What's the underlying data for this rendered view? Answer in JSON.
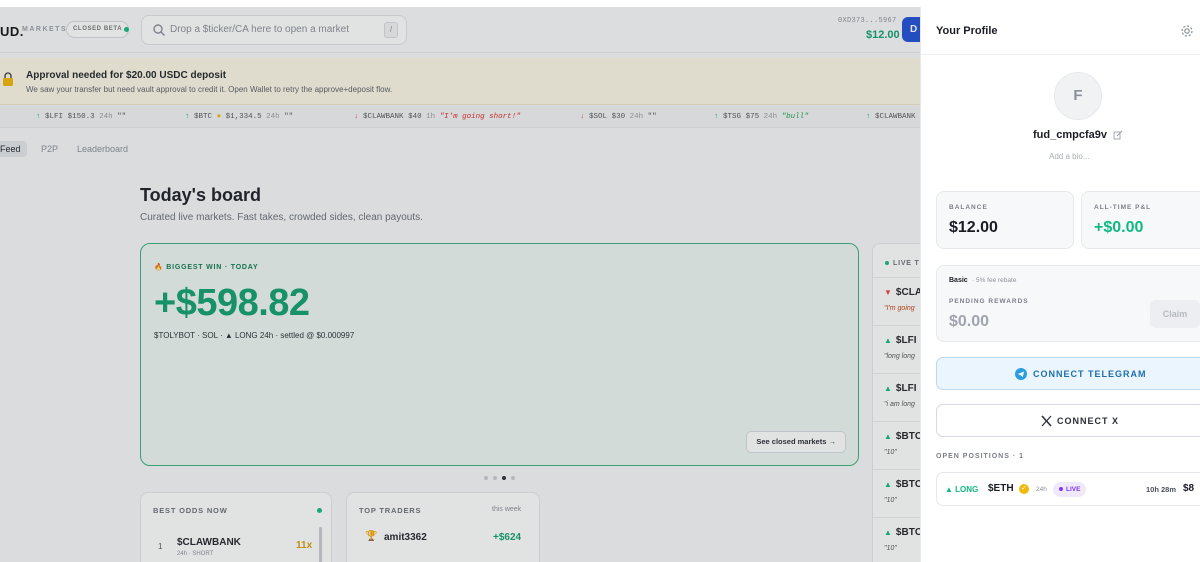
{
  "header": {
    "logo": "UD.",
    "logo_sub": "MARKETS",
    "beta": "CLOSED BETA",
    "search_placeholder": "Drop a $ticker/CA here to open a market",
    "search_kbd": "/",
    "wallet_address": "0XD373...5967",
    "wallet_balance": "$12.00",
    "deposit_label": "D"
  },
  "banner": {
    "title": "Approval needed for $20.00 USDC deposit",
    "desc": "We saw your transfer but need vault approval to credit it. Open Wallet to retry the approve+deposit flow."
  },
  "ticker": [
    {
      "dir": "↑",
      "sym": "$LFI",
      "price": "$150.3",
      "dur": "24h",
      "quote": "\"\""
    },
    {
      "dir": "↑",
      "sym": "$BTC",
      "price": "$1,334.5",
      "dur": "24h",
      "quote": "\"\""
    },
    {
      "dir": "↓",
      "sym": "$CLAWBANK",
      "price": "$40",
      "dur": "1h",
      "quote": "\"I'm going short!\""
    },
    {
      "dir": "↓",
      "sym": "$SOL",
      "price": "$30",
      "dur": "24h",
      "quote": "\"\""
    },
    {
      "dir": "↑",
      "sym": "$TSG",
      "price": "$75",
      "dur": "24h",
      "quote": "\"bull\""
    },
    {
      "dir": "↑",
      "sym": "$CLAWBANK",
      "price": "",
      "dur": "",
      "quote": ""
    }
  ],
  "tabs": [
    "Feed",
    "P2P",
    "Leaderboard"
  ],
  "board": {
    "title": "Today's board",
    "subtitle": "Curated live markets. Fast takes, crowded sides, clean payouts."
  },
  "win_card": {
    "label": "BIGGEST WIN · TODAY",
    "amount": "+$598.82",
    "meta": "$TOLYBOT · SOL · ▲ LONG 24h · settled @ $0.000997",
    "button": "See closed markets →"
  },
  "best_odds": {
    "title": "BEST ODDS NOW",
    "rank": "1",
    "name": "$CLAWBANK",
    "sub": "24h · SHORT",
    "mult": "11x"
  },
  "top_traders": {
    "title": "TOP TRADERS",
    "period": "this week",
    "name": "amit3362",
    "pnl": "+$624"
  },
  "live": {
    "title": "LIVE T",
    "items": [
      {
        "dir": "down",
        "sym": "$CLA",
        "quote": "\"I'm going"
      },
      {
        "dir": "up",
        "sym": "$LFI",
        "quote": "\"long long"
      },
      {
        "dir": "up",
        "sym": "$LFI",
        "quote": "\"i am long"
      },
      {
        "dir": "up",
        "sym": "$BTC",
        "quote": "\"10\""
      },
      {
        "dir": "up",
        "sym": "$BTC",
        "quote": "\"10\""
      },
      {
        "dir": "up",
        "sym": "$BTC",
        "quote": "\"10\""
      }
    ]
  },
  "profile": {
    "title": "Your Profile",
    "avatar_letter": "F",
    "username": "fud_cmpcfa9v",
    "bio_placeholder": "Add a bio...",
    "balance_label": "BALANCE",
    "balance": "$12.00",
    "pnl_label": "ALL-TIME P&L",
    "pnl": "+$0.00",
    "tier": "Basic",
    "tier_sub": "· 5% fee rebate",
    "pending_label": "PENDING REWARDS",
    "pending": "$0.00",
    "claim": "Claim",
    "telegram": "CONNECT TELEGRAM",
    "x": "CONNECT X",
    "positions_label": "OPEN POSITIONS · 1",
    "position": {
      "side": "▲ LONG",
      "sym": "$ETH",
      "dur": "24h",
      "status": "LIVE",
      "time": "10h 28m",
      "val": "$8"
    }
  },
  "colors": {
    "accent_green": "#10b981",
    "brand_blue": "#1d4ed8",
    "telegram": "#1e6fae",
    "live_purple": "#7c3aed"
  }
}
